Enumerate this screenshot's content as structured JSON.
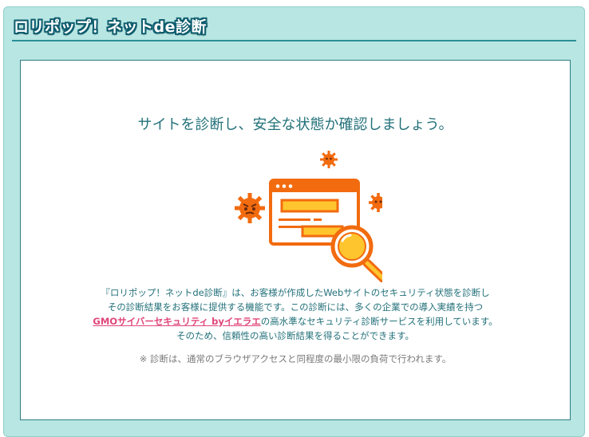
{
  "panel": {
    "title": "ロリポップ！ネットde診断"
  },
  "card": {
    "headline": "サイトを診断し、安全な状態か確認しましょう。",
    "description": {
      "line1": "『ロリポップ！ネットde診断』は、お客様が作成したWebサイトのセキュリティ状態を診断し",
      "line2": "その診断結果をお客様に提供する機能です。この診断には、多くの企業での導入実績を持つ",
      "link_text": "GMOサイバーセキュリティ byイエラエ",
      "line3_after_link": "の高水準なセキュリティ診断サービスを利用しています。",
      "line4": "そのため、信頼性の高い診断結果を得ることができます。"
    },
    "note": "※ 診断は、通常のブラウザアクセスと同程度の最小限の負荷で行われます。"
  },
  "illustration": {
    "icon": "website-scan-magnifier-with-viruses",
    "colors": {
      "orange": "#f26b0f",
      "yellow": "#ffc52e",
      "dark": "#6b2b0a"
    }
  },
  "colors": {
    "panel_bg": "#b8e6e3",
    "accent_teal": "#23717a",
    "link_pink": "#e0457a",
    "note_gray": "#7a7a7a"
  }
}
